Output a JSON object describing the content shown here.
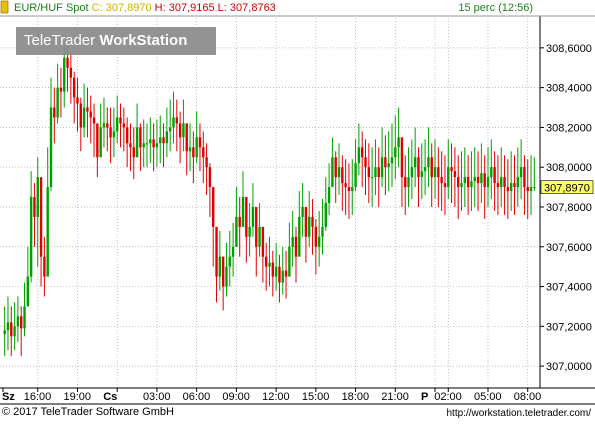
{
  "header": {
    "symbol": "EUR/HUF Spot",
    "close_label": "C:",
    "close_value": "307,8970",
    "high_label": "H:",
    "high_value": "307,9165",
    "low_label": "L:",
    "low_value": "307,8763",
    "interval": "15 perc (12:56)"
  },
  "brand": {
    "name_light": "TeleTrader ",
    "name_bold": "WorkStation"
  },
  "footer": {
    "copyright": "© 2017 TeleTrader Software GmbH",
    "url": "http://workstation.teletrader.com/"
  },
  "colors": {
    "up": "#00a000",
    "down": "#e00000",
    "current_badge": "#ffff66",
    "grid": "#aaaaaa"
  },
  "chart_data": {
    "type": "candlestick",
    "y_ticks": [
      "307,0000",
      "307,2000",
      "307,4000",
      "307,6000",
      "307,8000",
      "308,0000",
      "308,2000",
      "308,4000",
      "308,6000"
    ],
    "ylim": [
      306.9,
      308.75
    ],
    "current_value": "307,8970",
    "x_ticks": [
      {
        "label": "Sz",
        "bold": true
      },
      {
        "label": "16:00"
      },
      {
        "label": "19:00"
      },
      {
        "label": "Cs",
        "bold": true
      },
      {
        "label": "03:00"
      },
      {
        "label": "06:00"
      },
      {
        "label": "09:00"
      },
      {
        "label": "12:00"
      },
      {
        "label": "15:00"
      },
      {
        "label": "18:00"
      },
      {
        "label": "21:00"
      },
      {
        "label": "P",
        "bold": true
      },
      {
        "label": "02:00"
      },
      {
        "label": "05:00"
      },
      {
        "label": "08:00"
      }
    ],
    "x_tick_index": [
      0,
      10,
      22,
      34,
      46,
      58,
      70,
      82,
      94,
      106,
      118,
      130,
      134,
      146,
      158
    ],
    "grid": true,
    "series": [
      {
        "close": [
          307.18,
          307.22,
          307.15,
          307.2,
          307.25,
          307.19,
          307.3,
          307.45,
          307.85,
          307.75,
          307.95,
          307.55,
          307.45,
          307.9,
          308.3,
          308.25,
          308.4,
          308.38,
          308.55,
          308.5,
          308.45,
          308.35,
          308.32,
          308.2,
          308.3,
          308.28,
          308.25,
          308.22,
          308.05,
          308.2,
          308.22,
          308.2,
          308.15,
          308.18,
          308.25,
          308.22,
          308.2,
          308.12,
          308.1,
          308.05,
          308.2,
          308.1,
          308.12,
          308.12,
          308.14,
          308.1,
          308.12,
          308.15,
          308.12,
          308.18,
          308.2,
          308.25,
          308.22,
          308.15,
          308.22,
          308.08,
          308.1,
          308.05,
          308.15,
          308.1,
          308.05,
          308.0,
          307.9,
          307.7,
          307.45,
          307.55,
          307.4,
          307.5,
          307.55,
          307.6,
          307.75,
          307.7,
          307.85,
          307.65,
          307.7,
          307.8,
          307.6,
          307.7,
          307.55,
          307.5,
          307.52,
          307.45,
          307.5,
          307.42,
          307.48,
          307.45,
          307.6,
          307.65,
          307.55,
          307.75,
          307.8,
          307.65,
          307.75,
          307.7,
          307.6,
          307.65,
          307.7,
          307.82,
          307.9,
          308.05,
          307.95,
          308.0,
          307.92,
          307.9,
          307.88,
          307.9,
          308.02,
          308.1,
          308.05,
          308.0,
          307.95,
          307.95,
          308.0,
          307.95,
          308.05,
          308.0,
          308.02,
          308.05,
          308.1,
          308.15,
          307.95,
          307.9,
          307.95,
          308.0,
          308.05,
          307.95,
          307.98,
          308.0,
          308.05,
          307.95,
          308.0,
          307.95,
          307.92,
          307.9,
          308.0,
          307.98,
          307.95,
          307.9,
          307.92,
          307.95,
          307.9,
          307.93,
          307.95,
          307.92,
          307.97,
          307.9,
          307.95,
          308.0,
          307.92,
          307.9,
          307.95,
          307.9,
          307.88,
          307.92,
          307.9,
          307.95,
          308.0,
          307.9,
          307.88,
          307.9,
          307.9
        ],
        "high": [
          307.3,
          307.35,
          307.3,
          307.32,
          307.35,
          307.3,
          307.42,
          307.6,
          307.98,
          307.92,
          308.05,
          307.9,
          307.65,
          308.1,
          308.45,
          308.4,
          308.52,
          308.5,
          308.62,
          308.62,
          308.58,
          308.48,
          308.45,
          308.35,
          308.42,
          308.4,
          308.36,
          308.32,
          308.22,
          308.32,
          308.35,
          308.3,
          308.3,
          308.3,
          308.36,
          308.32,
          308.3,
          308.25,
          308.22,
          308.2,
          308.32,
          308.22,
          308.24,
          308.22,
          308.25,
          308.22,
          308.24,
          308.26,
          308.22,
          308.3,
          308.34,
          308.38,
          308.34,
          308.28,
          308.34,
          308.22,
          308.22,
          308.18,
          308.28,
          308.22,
          308.18,
          308.12,
          308.02,
          307.82,
          307.62,
          307.68,
          307.55,
          307.62,
          307.68,
          307.72,
          307.9,
          307.85,
          307.98,
          307.8,
          307.82,
          307.92,
          307.75,
          307.82,
          307.7,
          307.62,
          307.65,
          307.58,
          307.62,
          307.56,
          307.6,
          307.58,
          307.72,
          307.78,
          307.7,
          307.88,
          307.92,
          307.8,
          307.88,
          307.84,
          307.74,
          307.78,
          307.84,
          307.95,
          308.02,
          308.15,
          308.08,
          308.12,
          308.06,
          308.04,
          308.02,
          308.04,
          308.14,
          308.22,
          308.18,
          308.14,
          308.12,
          308.1,
          308.14,
          308.1,
          308.2,
          308.16,
          308.18,
          308.22,
          308.26,
          308.3,
          308.1,
          308.06,
          308.1,
          308.14,
          308.2,
          308.1,
          308.12,
          308.14,
          308.2,
          308.12,
          308.14,
          308.1,
          308.08,
          308.06,
          308.14,
          308.12,
          308.1,
          308.06,
          308.08,
          308.1,
          308.06,
          308.08,
          308.1,
          308.08,
          308.12,
          308.06,
          308.1,
          308.14,
          308.08,
          308.06,
          308.1,
          308.06,
          308.04,
          308.08,
          308.06,
          308.1,
          308.14,
          308.06,
          308.04,
          308.06,
          308.05
        ],
        "low": [
          307.05,
          307.08,
          307.05,
          307.08,
          307.12,
          307.05,
          307.15,
          307.3,
          307.42,
          307.6,
          307.5,
          307.4,
          307.35,
          307.45,
          307.88,
          308.12,
          308.22,
          308.25,
          308.3,
          308.38,
          308.32,
          308.22,
          308.18,
          308.08,
          308.15,
          308.15,
          308.12,
          308.05,
          307.95,
          308.05,
          308.1,
          308.08,
          308.02,
          308.05,
          308.12,
          308.1,
          308.08,
          308.0,
          307.98,
          307.94,
          308.05,
          307.98,
          308.0,
          308.0,
          308.02,
          307.98,
          308.0,
          308.02,
          308.0,
          308.05,
          308.08,
          308.12,
          308.08,
          308.02,
          308.08,
          307.96,
          307.98,
          307.92,
          308.02,
          307.98,
          307.92,
          307.86,
          307.75,
          307.5,
          307.32,
          307.38,
          307.28,
          307.35,
          307.4,
          307.45,
          307.6,
          307.55,
          307.7,
          307.52,
          307.55,
          307.65,
          307.45,
          307.55,
          307.42,
          307.38,
          307.4,
          307.35,
          307.38,
          307.32,
          307.36,
          307.34,
          307.45,
          307.5,
          307.42,
          307.6,
          307.65,
          307.52,
          307.6,
          307.56,
          307.46,
          307.5,
          307.56,
          307.68,
          307.76,
          307.9,
          307.82,
          307.86,
          307.78,
          307.76,
          307.74,
          307.76,
          307.88,
          307.96,
          307.9,
          307.86,
          307.82,
          307.8,
          307.86,
          307.8,
          307.9,
          307.86,
          307.88,
          307.9,
          307.94,
          308.0,
          307.8,
          307.76,
          307.8,
          307.84,
          307.9,
          307.8,
          307.84,
          307.86,
          307.9,
          307.8,
          307.84,
          307.8,
          307.78,
          307.76,
          307.84,
          307.82,
          307.8,
          307.74,
          307.78,
          307.8,
          307.76,
          307.78,
          307.8,
          307.78,
          307.82,
          307.74,
          307.8,
          307.84,
          307.78,
          307.76,
          307.8,
          307.76,
          307.74,
          307.78,
          307.76,
          307.8,
          307.84,
          307.76,
          307.74,
          307.76,
          307.88
        ]
      }
    ]
  }
}
